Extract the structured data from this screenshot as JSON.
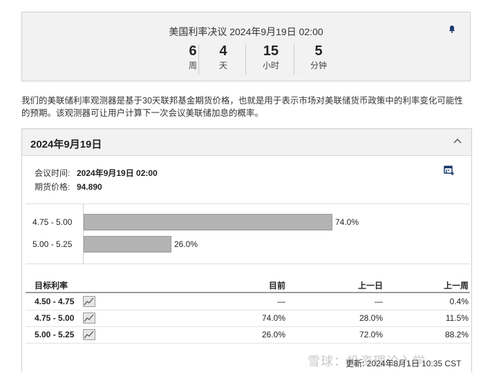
{
  "countdown": {
    "title": "美国利率决议 2024年9月19日 02:00",
    "units": [
      {
        "value": "6",
        "label": "周"
      },
      {
        "value": "4",
        "label": "天"
      },
      {
        "value": "15",
        "label": "小时"
      },
      {
        "value": "5",
        "label": "分钟"
      }
    ]
  },
  "description": "我们的美联储利率观测器是基于30天联邦基金期货价格，也就是用于表示市场对美联储货币政策中的利率变化可能性的预期。该观测器可让用户计算下一次会议美联储加息的概率。",
  "panel": {
    "title": "2024年9月19日",
    "meeting_label": "会议时间:",
    "meeting_value": "2024年9月19日 02:00",
    "futures_label": "期货价格:",
    "futures_value": "94.890"
  },
  "chart_data": {
    "type": "bar",
    "orientation": "horizontal",
    "categories": [
      "4.75 - 5.00",
      "5.00 - 5.25"
    ],
    "values": [
      74.0,
      26.0
    ],
    "value_labels": [
      "74.0%",
      "26.0%"
    ]
  },
  "table": {
    "headers": {
      "rate": "目标利率",
      "current": "目前",
      "prev_day": "上一日",
      "prev_week": "上一周"
    },
    "rows": [
      {
        "rate": "4.50 - 4.75",
        "current": "—",
        "prev_day": "—",
        "prev_week": "0.4%"
      },
      {
        "rate": "4.75 - 5.00",
        "current": "74.0%",
        "prev_day": "28.0%",
        "prev_week": "11.5%"
      },
      {
        "rate": "5.00 - 5.25",
        "current": "26.0%",
        "prev_day": "72.0%",
        "prev_week": "88.2%"
      }
    ]
  },
  "footer": {
    "updated": "更新: 2024年8月1日 10:35 CST"
  },
  "watermark": "雪球：投资理论入学"
}
